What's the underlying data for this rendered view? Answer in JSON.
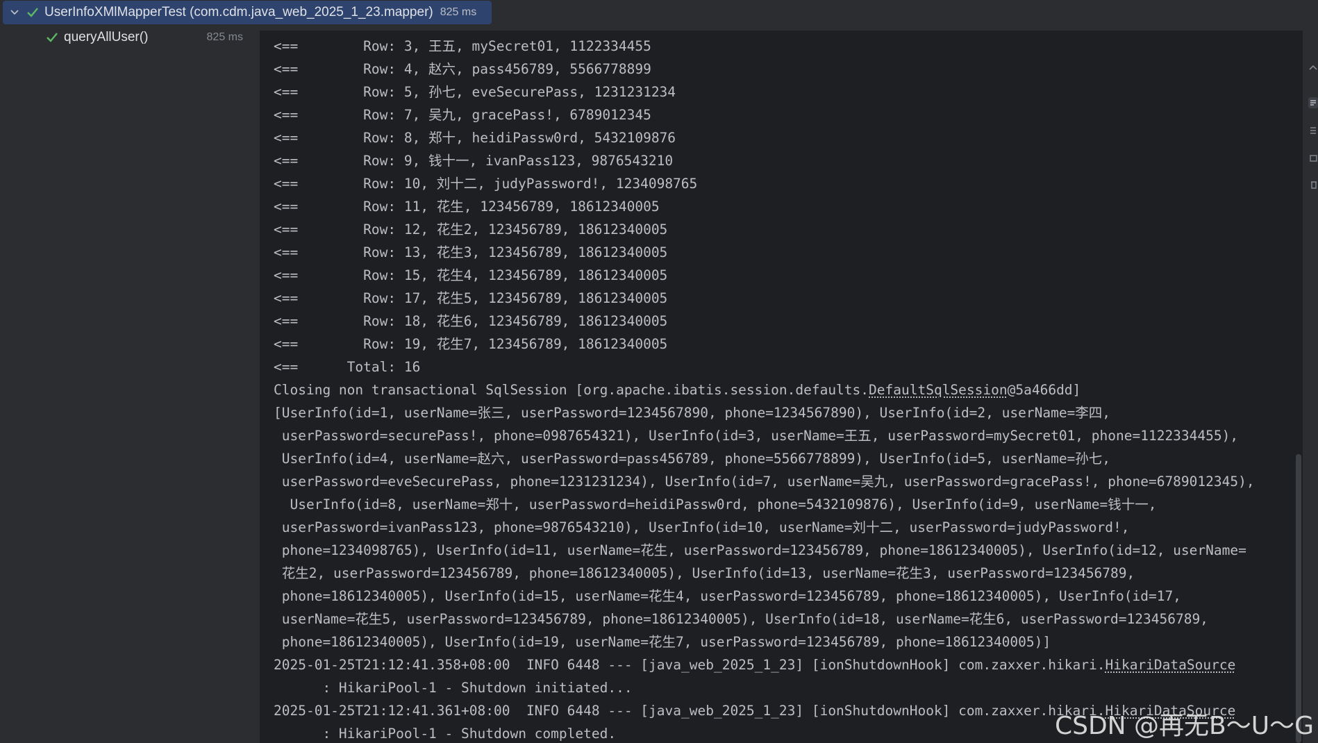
{
  "test_tree": {
    "class_name": "UserInfoXMlMapperTest (com.cdm.java_web_2025_1_23.mapper)",
    "class_time": "825 ms",
    "method_name": "queryAllUser()",
    "method_time": "825 ms",
    "status_color": "#5fb865"
  },
  "console": {
    "lines": [
      [
        "<==        Row: 3, 王五, mySecret01, 1122334455"
      ],
      [
        "<==        Row: 4, 赵六, pass456789, 5566778899"
      ],
      [
        "<==        Row: 5, 孙七, eveSecurePass, 1231231234"
      ],
      [
        "<==        Row: 7, 吴九, gracePass!, 6789012345"
      ],
      [
        "<==        Row: 8, 郑十, heidiPassw0rd, 5432109876"
      ],
      [
        "<==        Row: 9, 钱十一, ivanPass123, 9876543210"
      ],
      [
        "<==        Row: 10, 刘十二, judyPassword!, 1234098765"
      ],
      [
        "<==        Row: 11, 花生, 123456789, 18612340005"
      ],
      [
        "<==        Row: 12, 花生2, 123456789, 18612340005"
      ],
      [
        "<==        Row: 13, 花生3, 123456789, 18612340005"
      ],
      [
        "<==        Row: 15, 花生4, 123456789, 18612340005"
      ],
      [
        "<==        Row: 17, 花生5, 123456789, 18612340005"
      ],
      [
        "<==        Row: 18, 花生6, 123456789, 18612340005"
      ],
      [
        "<==        Row: 19, 花生7, 123456789, 18612340005"
      ],
      [
        "<==      Total: 16"
      ],
      [
        "Closing non transactional SqlSession [org.apache.ibatis.session.defaults.",
        "DefaultSqlSession",
        "@5a466dd]"
      ],
      [
        "[UserInfo(id=1, userName=张三, userPassword=1234567890, phone=1234567890), UserInfo(id=2, userName=李四,"
      ],
      [
        " userPassword=securePass!, phone=0987654321), UserInfo(id=3, userName=王五, userPassword=mySecret01, phone=1122334455),"
      ],
      [
        " UserInfo(id=4, userName=赵六, userPassword=pass456789, phone=5566778899), UserInfo(id=5, userName=孙七,"
      ],
      [
        " userPassword=eveSecurePass, phone=1231231234), UserInfo(id=7, userName=吴九, userPassword=gracePass!, phone=6789012345),"
      ],
      [
        "  UserInfo(id=8, userName=郑十, userPassword=heidiPassw0rd, phone=5432109876), UserInfo(id=9, userName=钱十一,"
      ],
      [
        " userPassword=ivanPass123, phone=9876543210), UserInfo(id=10, userName=刘十二, userPassword=judyPassword!,"
      ],
      [
        " phone=1234098765), UserInfo(id=11, userName=花生, userPassword=123456789, phone=18612340005), UserInfo(id=12, userName="
      ],
      [
        " 花生2, userPassword=123456789, phone=18612340005), UserInfo(id=13, userName=花生3, userPassword=123456789,"
      ],
      [
        " phone=18612340005), UserInfo(id=15, userName=花生4, userPassword=123456789, phone=18612340005), UserInfo(id=17,"
      ],
      [
        " userName=花生5, userPassword=123456789, phone=18612340005), UserInfo(id=18, userName=花生6, userPassword=123456789,"
      ],
      [
        " phone=18612340005), UserInfo(id=19, userName=花生7, userPassword=123456789, phone=18612340005)]"
      ],
      [
        "2025-01-25T21:12:41.358+08:00  INFO 6448 --- [java_web_2025_1_23] [ionShutdownHook] com.zaxxer.hikari.",
        "HikariDataSource",
        ""
      ],
      [
        "      : HikariPool-1 - Shutdown initiated..."
      ],
      [
        "2025-01-25T21:12:41.361+08:00  INFO 6448 --- [java_web_2025_1_23] [ionShutdownHook] com.zaxxer.hikari.",
        "HikariDataSource",
        ""
      ],
      [
        "      : HikariPool-1 - Shutdown completed."
      ]
    ]
  },
  "watermark": "CSDN @再无B～U～G"
}
